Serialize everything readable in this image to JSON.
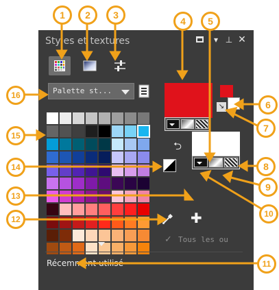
{
  "panel": {
    "title": "Styles et textures",
    "window_buttons": {
      "maximize": "",
      "dropdown": "▾",
      "pin": "⊥",
      "close": "✕"
    }
  },
  "tabs": [
    {
      "icon": "swatch-grid-icon",
      "active": true
    },
    {
      "icon": "gradient-icon",
      "active": false
    },
    {
      "icon": "sliders-icon",
      "active": false
    }
  ],
  "palette_dropdown": {
    "value": "Palette st..."
  },
  "palette_grid": {
    "rows": [
      [
        "#ffffff",
        "#ececec",
        "#d7d7d7",
        "#c4c4c4",
        "#b1b1b1",
        "#9e9e9e",
        "#8b8b8b",
        "#787878"
      ],
      [
        "#656565",
        "#525252",
        "#3f3f3f",
        "#1e1e1e",
        "#000000",
        "#9dd7f7",
        "#78d2f7",
        "#1ab5ef"
      ],
      [
        "#049dd8",
        "#00789c",
        "#005f73",
        "#004b5c",
        "#003847",
        "#c6e9fb",
        "#a8c8f3",
        "#7fa8ee"
      ],
      [
        "#2f6cd1",
        "#1d56b4",
        "#113f99",
        "#0a2c7a",
        "#061d5b",
        "#c7c7fb",
        "#a8a8f3",
        "#8b8bec"
      ],
      [
        "#7860eb",
        "#623ec9",
        "#5124b3",
        "#3f1593",
        "#2e0a70",
        "#e8bff2",
        "#d79dec",
        "#c07de2"
      ],
      [
        "#c873ef",
        "#b652e0",
        "#9e2ec9",
        "#7f1aa8",
        "#5e0d7f",
        "#3b0755",
        "#2a0444",
        "#1c0233"
      ],
      [
        "#e85de8",
        "#d13cd1",
        "#b01fb0",
        "#8e158e",
        "#6b0f6b",
        "#fbc6d9",
        "#f7a6c0",
        "#f184a5"
      ],
      [
        "#360512",
        "#ffbdbd",
        "#ff9e9e",
        "#ff7f7f",
        "#ff5f5f",
        "#ff3e3e",
        "#ff1f1f",
        "#e80000"
      ],
      [
        "#7a0d0d",
        "#a01414",
        "#c41a1a",
        "#e22020",
        "#ff2a1a",
        "#ff5a1a",
        "#ff7b22",
        "#ff9a33"
      ],
      [
        "#5a1e06",
        "#7e2c08",
        "#fde9d9",
        "#fdd7b9",
        "#fcc597",
        "#fbb277",
        "#f99e55",
        "#f68a34"
      ],
      [
        "#a04a10",
        "#c05a14",
        "#e06a18",
        "#fde2c7",
        "#fbc895",
        "#f9b067",
        "#f79939",
        "#f5830b"
      ]
    ],
    "selected": {
      "row": 1,
      "col": 7
    }
  },
  "fg_color": "#e0121b",
  "bg_color": "#ffffff",
  "style_options": [
    "color-icon",
    "gradient-icon",
    "pattern-icon"
  ],
  "swap_button": {
    "icon": "swap-arrows-icon"
  },
  "reset_button": {
    "icon": "black-white-reset-icon"
  },
  "add_button": {
    "icon": "plus-icon",
    "label": "✚"
  },
  "eyedropper": {
    "icon": "eyedropper-icon"
  },
  "all_tools": {
    "checked": true,
    "label": "Tous les ou"
  },
  "recent_label": "Récemment utilisé",
  "annotations": [
    "1",
    "2",
    "3",
    "4",
    "5",
    "6",
    "7",
    "8",
    "9",
    "10",
    "11",
    "12",
    "13",
    "14",
    "15",
    "16"
  ],
  "annotation_color": "#f0a11a"
}
